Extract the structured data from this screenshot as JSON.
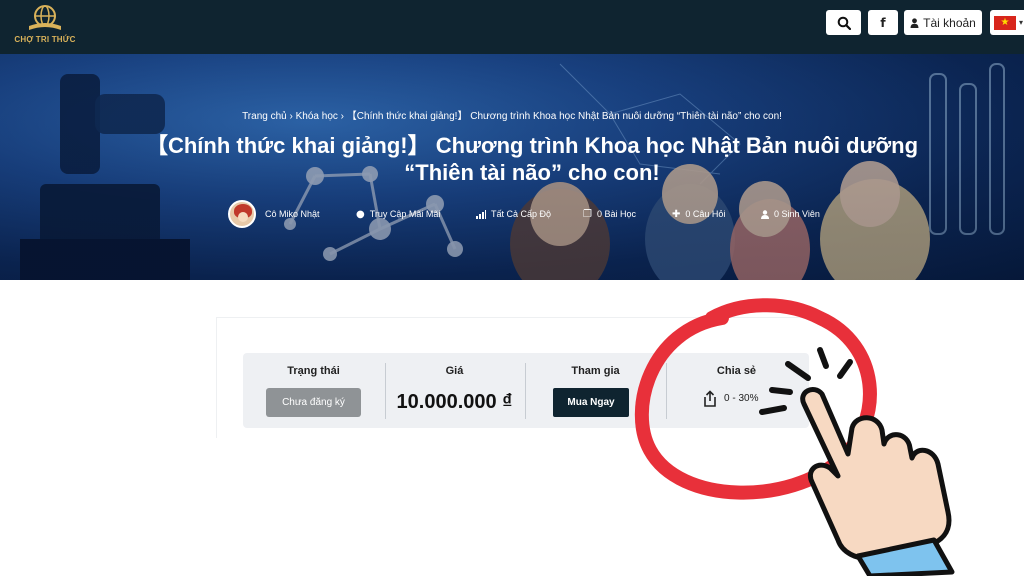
{
  "nav": {
    "logo_text": "CHỢ TRI THỨC",
    "facebook_label": "f",
    "account_label": "Tài khoản",
    "icons": {
      "search": "search-icon",
      "account": "user-icon",
      "flag": "vietnam-flag-icon"
    }
  },
  "hero": {
    "breadcrumb": {
      "home": "Trang chủ",
      "courses": "Khóa học",
      "current": "【Chính thức khai giảng!】 Chương trình Khoa học Nhật Bản nuôi dưỡng “Thiên tài não” cho con!",
      "separator": "›"
    },
    "title_line1": "【Chính thức khai giảng!】 Chương trình Khoa học Nhật Bản nuôi dưỡng",
    "title_line2": "“Thiên tài não” cho con!",
    "meta": {
      "instructor": "Cô Miko Nhật",
      "access": "Truy Cập Mãi Mãi",
      "level": "Tất Cả Cấp Độ",
      "lessons": "0 Bài Học",
      "questions": "0 Câu Hỏi",
      "students": "0 Sinh Viên"
    }
  },
  "course_info": {
    "status_title": "Trạng thái",
    "status_button": "Chưa đăng ký",
    "price_title": "Giá",
    "price_value": "10.000.000 ₫",
    "join_title": "Tham gia",
    "buy_button": "Mua Ngay",
    "share_title": "Chia sẻ",
    "share_value": "0 - 30%"
  },
  "colors": {
    "nav_bg": "#0f2430",
    "accent_gold": "#d9b25a",
    "buy_button": "#0f2430",
    "status_button": "#8f9396",
    "annotation_circle": "#e8303a",
    "hand_sleeve": "#7ec3ee"
  }
}
